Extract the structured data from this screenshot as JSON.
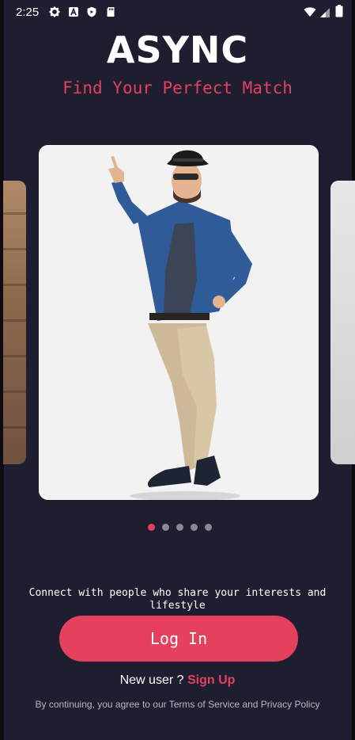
{
  "status_bar": {
    "time": "2:25",
    "icons": [
      "gear-icon",
      "a-icon",
      "shield-icon",
      "sd-card-icon",
      "wifi-icon",
      "signal-icon",
      "battery-icon"
    ]
  },
  "header": {
    "title": "ASYNC",
    "tagline": "Find Your Perfect Match"
  },
  "carousel": {
    "page_count": 5,
    "active_index": 0
  },
  "main": {
    "description": "Connect with people who share your interests and lifestyle",
    "login_label": "Log In",
    "new_user_text": "New user ? ",
    "signup_label": "Sign Up",
    "legal_text": "By continuing, you agree to our Terms of Service and Privacy Policy"
  },
  "colors": {
    "background": "#1f1e30",
    "accent": "#e5405d",
    "dot_inactive": "#8a8a96"
  }
}
